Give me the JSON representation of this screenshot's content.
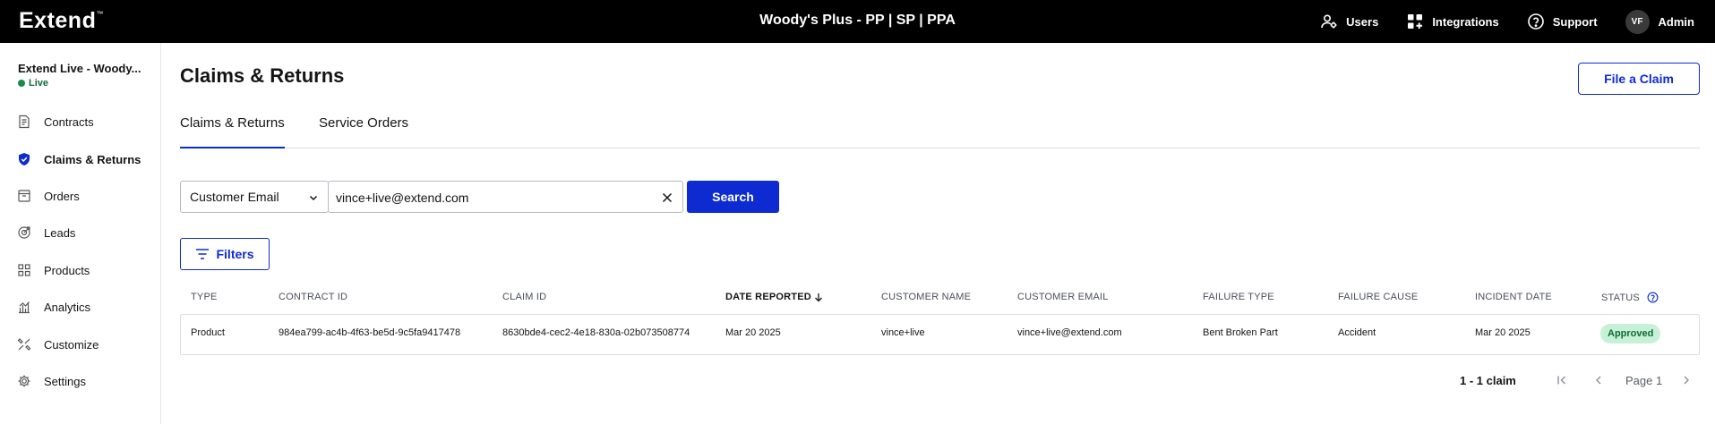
{
  "topbar": {
    "logo": "Extend",
    "logo_mark": "™",
    "store_title": "Woody's Plus - PP | SP | PPA",
    "nav": [
      {
        "label": "Users",
        "icon": "users-icon"
      },
      {
        "label": "Integrations",
        "icon": "integrations-icon"
      },
      {
        "label": "Support",
        "icon": "help-circle-icon"
      }
    ],
    "user_initials": "VF",
    "user_role": "Admin"
  },
  "sidebar": {
    "org_name": "Extend Live - Woody...",
    "env_label": "Live",
    "items": [
      {
        "label": "Contracts",
        "icon": "contracts-icon"
      },
      {
        "label": "Claims & Returns",
        "icon": "shield-check-icon",
        "active": true
      },
      {
        "label": "Orders",
        "icon": "orders-icon"
      },
      {
        "label": "Leads",
        "icon": "leads-icon"
      },
      {
        "label": "Products",
        "icon": "products-grid-icon"
      },
      {
        "label": "Analytics",
        "icon": "analytics-icon"
      },
      {
        "label": "Customize",
        "icon": "customize-icon"
      },
      {
        "label": "Settings",
        "icon": "gear-icon"
      }
    ]
  },
  "main": {
    "title": "Claims & Returns",
    "file_claim_label": "File a Claim",
    "tabs": [
      {
        "label": "Claims & Returns",
        "active": true
      },
      {
        "label": "Service Orders",
        "active": false
      }
    ],
    "search": {
      "type_value": "Customer Email",
      "query_value": "vince+live@extend.com",
      "button_label": "Search"
    },
    "filters_label": "Filters",
    "table": {
      "columns": [
        "TYPE",
        "CONTRACT ID",
        "CLAIM ID",
        "DATE REPORTED",
        "CUSTOMER NAME",
        "CUSTOMER EMAIL",
        "FAILURE TYPE",
        "FAILURE CAUSE",
        "INCIDENT DATE",
        "STATUS"
      ],
      "sorted_column": "DATE REPORTED",
      "rows": [
        {
          "type": "Product",
          "contract_id": "984ea799-ac4b-4f63-be5d-9c5fa9417478",
          "claim_id": "8630bde4-cec2-4e18-830a-02b073508774",
          "date_reported": "Mar 20 2025",
          "customer_name": "vince+live",
          "customer_email": "vince+live@extend.com",
          "failure_type": "Bent Broken Part",
          "failure_cause": "Accident",
          "incident_date": "Mar 20 2025",
          "status": "Approved"
        }
      ]
    },
    "pagination": {
      "count_label": "1 - 1 claim",
      "page_label": "Page 1"
    }
  },
  "colors": {
    "accent": "#0d2bd1",
    "topbar": "#000000",
    "live_green": "#1c8a4b",
    "approved_bg": "#c6f1d7",
    "approved_text": "#0f6b36"
  }
}
